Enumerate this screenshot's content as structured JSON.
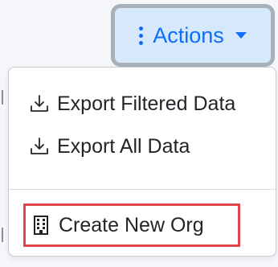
{
  "actions_button": {
    "label": "Actions",
    "kebab_icon": "kebab-vertical-icon",
    "caret_icon": "caret-down-icon"
  },
  "menu": {
    "items": [
      {
        "label": "Export Filtered Data",
        "icon": "download-icon"
      },
      {
        "label": "Export All Data",
        "icon": "download-icon"
      },
      {
        "label": "Create New Org",
        "icon": "building-icon"
      }
    ],
    "highlighted_item": "Create New Org"
  },
  "colors": {
    "accent": "#0d6efd",
    "button_bg": "#d6e8fb",
    "highlight": "#e0474c"
  }
}
